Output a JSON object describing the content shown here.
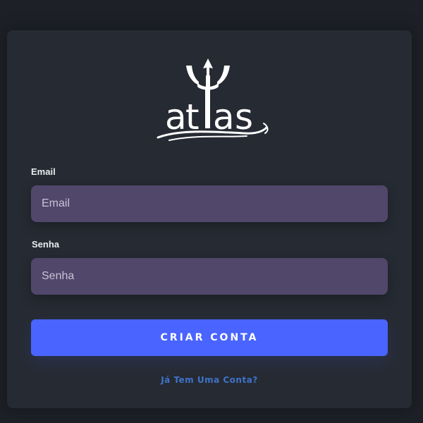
{
  "logo": {
    "name": "atlas",
    "icon": "trident-icon"
  },
  "form": {
    "email_label": "Email",
    "email_placeholder": "Email",
    "email_value": "",
    "password_label": "Senha",
    "password_placeholder": "Senha",
    "password_value": "",
    "submit_label": "CRIAR CONTA",
    "login_link": "Já Tem Uma Conta?"
  },
  "colors": {
    "background": "#1d2127",
    "card": "#262b33",
    "input_bg": "#51476b",
    "button": "#4a64ff",
    "link": "#3f73c9"
  }
}
